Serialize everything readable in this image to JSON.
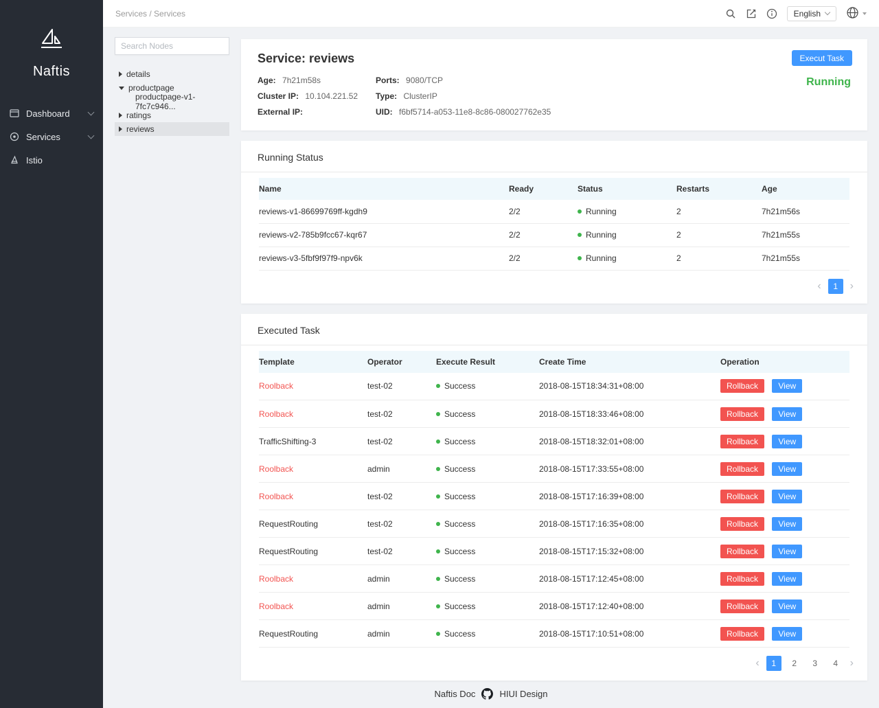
{
  "colors": {
    "accent": "#4098ff",
    "danger": "#f25350",
    "success": "#3fb44c",
    "sidebar_bg": "#272c34"
  },
  "sidebar": {
    "logo_text": "Naftis",
    "items": [
      {
        "label": "Dashboard"
      },
      {
        "label": "Services"
      },
      {
        "label": "Istio"
      }
    ]
  },
  "header": {
    "breadcrumb": "Services / Services",
    "language": "English"
  },
  "tree": {
    "search_placeholder": "Search Nodes",
    "items": [
      {
        "label": "details"
      },
      {
        "label": "productpage",
        "children": [
          {
            "label": "productpage-v1-7fc7c946..."
          }
        ]
      },
      {
        "label": "ratings"
      },
      {
        "label": "reviews"
      }
    ]
  },
  "service": {
    "title": "Service: reviews",
    "exec_task_button": "Execut Task",
    "status": "Running",
    "fields": [
      {
        "label": "Age:",
        "value": "7h21m58s"
      },
      {
        "label": "Ports:",
        "value": "9080/TCP"
      },
      {
        "label": "Cluster IP:",
        "value": "10.104.221.52"
      },
      {
        "label": "Type:",
        "value": "ClusterIP"
      },
      {
        "label": "External IP:",
        "value": ""
      },
      {
        "label": "UID:",
        "value": "f6bf5714-a053-11e8-8c86-080027762e35"
      }
    ]
  },
  "running_status": {
    "title": "Running Status",
    "columns": [
      "Name",
      "Ready",
      "Status",
      "Restarts",
      "Age"
    ],
    "rows": [
      {
        "name": "reviews-v1-86699769ff-kgdh9",
        "ready": "2/2",
        "status": "Running",
        "restarts": "2",
        "age": "7h21m56s"
      },
      {
        "name": "reviews-v2-785b9fcc67-kqr67",
        "ready": "2/2",
        "status": "Running",
        "restarts": "2",
        "age": "7h21m55s"
      },
      {
        "name": "reviews-v3-5fbf9f97f9-npv6k",
        "ready": "2/2",
        "status": "Running",
        "restarts": "2",
        "age": "7h21m55s"
      }
    ],
    "pagination": {
      "prev": "‹",
      "next": "›",
      "pages": [
        "1"
      ],
      "active": "1"
    }
  },
  "executed_task": {
    "title": "Executed Task",
    "columns": [
      "Template",
      "Operator",
      "Execute Result",
      "Create Time",
      "Operation"
    ],
    "rollback_label": "Rollback",
    "view_label": "View",
    "rows": [
      {
        "template": "Roolback",
        "operator": "test-02",
        "result": "Success",
        "created": "2018-08-15T18:34:31+08:00",
        "red": true
      },
      {
        "template": "Roolback",
        "operator": "test-02",
        "result": "Success",
        "created": "2018-08-15T18:33:46+08:00",
        "red": true
      },
      {
        "template": "TrafficShifting-3",
        "operator": "test-02",
        "result": "Success",
        "created": "2018-08-15T18:32:01+08:00",
        "red": false
      },
      {
        "template": "Roolback",
        "operator": "admin",
        "result": "Success",
        "created": "2018-08-15T17:33:55+08:00",
        "red": true
      },
      {
        "template": "Roolback",
        "operator": "test-02",
        "result": "Success",
        "created": "2018-08-15T17:16:39+08:00",
        "red": true
      },
      {
        "template": "RequestRouting",
        "operator": "test-02",
        "result": "Success",
        "created": "2018-08-15T17:16:35+08:00",
        "red": false
      },
      {
        "template": "RequestRouting",
        "operator": "test-02",
        "result": "Success",
        "created": "2018-08-15T17:15:32+08:00",
        "red": false
      },
      {
        "template": "Roolback",
        "operator": "admin",
        "result": "Success",
        "created": "2018-08-15T17:12:45+08:00",
        "red": true
      },
      {
        "template": "Roolback",
        "operator": "admin",
        "result": "Success",
        "created": "2018-08-15T17:12:40+08:00",
        "red": true
      },
      {
        "template": "RequestRouting",
        "operator": "admin",
        "result": "Success",
        "created": "2018-08-15T17:10:51+08:00",
        "red": false
      }
    ],
    "pagination": {
      "prev": "‹",
      "next": "›",
      "pages": [
        "1",
        "2",
        "3",
        "4"
      ],
      "active": "1"
    }
  },
  "footer": {
    "doc_link": "Naftis Doc",
    "design_link": "HIUI Design"
  }
}
